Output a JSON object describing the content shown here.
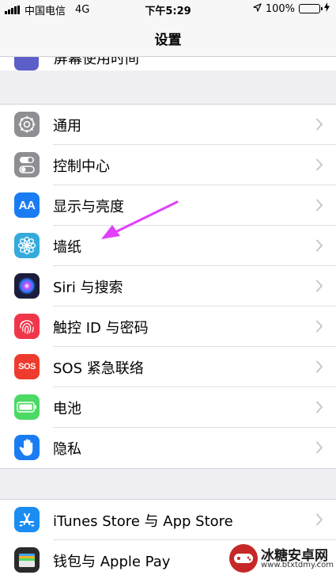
{
  "status_bar": {
    "carrier": "中国电信",
    "network": "4G",
    "time": "下午5:29",
    "battery_percent": "100%",
    "battery_level": 1.0,
    "icons": [
      "signal-icon",
      "location-icon",
      "battery-icon",
      "charging-icon"
    ]
  },
  "nav": {
    "title": "设置"
  },
  "peek_row": {
    "label": "屏幕使用时间"
  },
  "groups": [
    {
      "items": [
        {
          "label": "通用",
          "icon": "gear-icon",
          "color": "#8e8e93"
        },
        {
          "label": "控制中心",
          "icon": "toggles-icon",
          "color": "#8e8e93"
        },
        {
          "label": "显示与亮度",
          "icon": "aa-icon",
          "icon_text": "AA",
          "color": "#1a7cf2"
        },
        {
          "label": "墙纸",
          "icon": "flower-icon",
          "color": "#35aadc"
        },
        {
          "label": "Siri 与搜索",
          "icon": "siri-icon",
          "color": "#1c1c3c"
        },
        {
          "label": "触控 ID 与密码",
          "icon": "fingerprint-icon",
          "color": "#f0364a"
        },
        {
          "label": "SOS 紧急联络",
          "icon": "sos-icon",
          "icon_text": "SOS",
          "color": "#ef3b2d"
        },
        {
          "label": "电池",
          "icon": "battery-icon",
          "color": "#4cd964"
        },
        {
          "label": "隐私",
          "icon": "hand-icon",
          "color": "#1a7cf2"
        }
      ]
    },
    {
      "items": [
        {
          "label": "iTunes Store 与 App Store",
          "icon": "app-store-icon",
          "color": "#1a8cf2"
        },
        {
          "label": "钱包与 Apple Pay",
          "icon": "wallet-icon",
          "color": "#2b2b2b"
        }
      ]
    }
  ],
  "annotation": {
    "color": "#e040fb"
  },
  "watermark": {
    "title": "冰糖安卓网",
    "url": "www.btxtdmy.com"
  }
}
